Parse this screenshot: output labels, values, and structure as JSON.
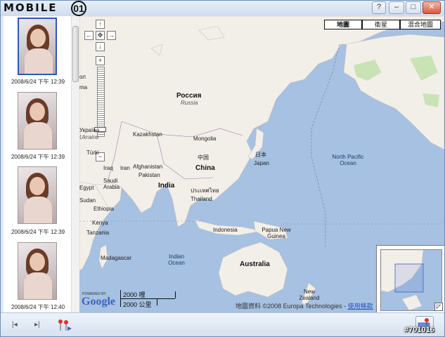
{
  "app": {
    "logo_text": "MOBILE",
    "logo_mark": "01"
  },
  "window_controls": {
    "help": "?",
    "minimize": "–",
    "maximize": "□",
    "close": "✕"
  },
  "sidebar": {
    "photos": [
      {
        "date": "2008/6/24 下午 12:39",
        "selected": true
      },
      {
        "date": "2008/6/24 下午 12:39",
        "selected": false
      },
      {
        "date": "2008/6/24 下午 12:39",
        "selected": false
      },
      {
        "date": "2008/6/24 下午 12:40",
        "selected": false
      }
    ]
  },
  "map": {
    "map_types": [
      {
        "label": "地圖",
        "active": true
      },
      {
        "label": "衛星",
        "active": false
      },
      {
        "label": "混合地圖",
        "active": false
      }
    ],
    "pan": {
      "up": "↑",
      "left": "←",
      "center": "✥",
      "right": "→",
      "down": "↓"
    },
    "zoom": {
      "in": "+",
      "out": "−"
    },
    "labels": {
      "russia": "Россия",
      "russia_en": "Russia",
      "kazakhstan": "Kazakhstan",
      "mongolia": "Mongolia",
      "china_cn": "中国",
      "china": "China",
      "japan_cn": "日本",
      "japan": "Japan",
      "afghanistan": "Afghanistan",
      "pakistan": "Pakistan",
      "iraq": "Iraq",
      "iran": "Iran",
      "india": "India",
      "thailand_th": "ประเทศไทย",
      "thailand": "Thailand",
      "saudi": "Saudi Arabia",
      "egypt": "Egypt",
      "sudan": "Sudan",
      "ethiopia": "Ethiopia",
      "kenya": "Kenya",
      "tanzania": "Tanzania",
      "madagascar": "Madagascar",
      "indonesia": "Indonesia",
      "png": "Papua New Guinea",
      "australia": "Australia",
      "new_zealand": "New Zealand",
      "north_pacific": "North Pacific Ocean",
      "indian_ocean": "Indian Ocean",
      "ukraine": "Україна",
      "ukraine_en": "Ukraine",
      "turkey": "Türki",
      "left_edge_1": "ол",
      "left_edge_2": "ma"
    },
    "scale": {
      "top": "2000 哩",
      "bottom": "2000 公里"
    },
    "powered_by": "POWERED BY",
    "google": "Google",
    "copyright": "地圖資料 ©2008 Europa Technologies -",
    "terms_link": "使用條款"
  },
  "bottombar": {
    "prev": "|◂",
    "next": "▸|"
  },
  "watermark": "#701016",
  "colors": {
    "water": "#a6c1e1",
    "land": "#f2efe9",
    "green": "#c9e3b5",
    "border": "#9b7ea6",
    "selected": "#2f58b8"
  }
}
